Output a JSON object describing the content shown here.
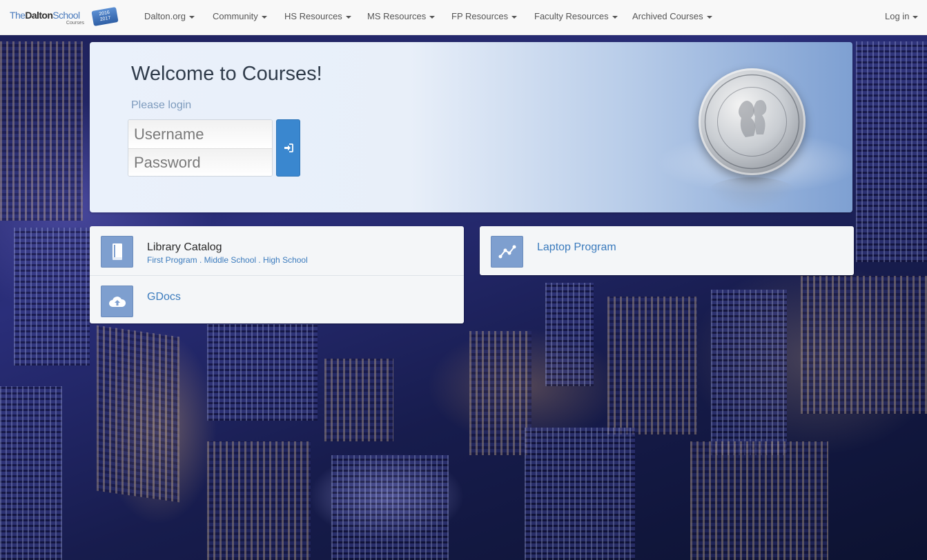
{
  "brand": {
    "name_prefix": "The",
    "name_main": "Dalton",
    "name_suffix": "School",
    "sub": "Courses",
    "badge_line1": "2016",
    "badge_line2": "2017"
  },
  "nav": {
    "items": [
      {
        "label": "Dalton.org"
      },
      {
        "label": "Community"
      },
      {
        "label": "HS Resources"
      },
      {
        "label": "MS Resources"
      },
      {
        "label": "FP Resources"
      },
      {
        "label": "Faculty Resources"
      },
      {
        "label": "Archived Courses"
      }
    ],
    "login_label": "Log in"
  },
  "login": {
    "title": "Welcome to Courses!",
    "prompt": "Please login",
    "username_placeholder": "Username",
    "password_placeholder": "Password",
    "submit_icon": "sign-in-icon"
  },
  "seal": {
    "icon": "dalton-school-seal"
  },
  "links": {
    "left": [
      {
        "title": "Library Catalog",
        "subtitle": "First Program . Middle School . High School",
        "icon": "book-icon"
      },
      {
        "title": "GDocs",
        "icon": "cloud-upload-icon"
      }
    ],
    "right": [
      {
        "title": "Laptop Program",
        "icon": "line-chart-icon"
      }
    ]
  },
  "colors": {
    "accent": "#3a87cf",
    "link": "#3b7bbd",
    "icon_tile": "#7e9fcf",
    "navbar": "#f8f8f8"
  }
}
